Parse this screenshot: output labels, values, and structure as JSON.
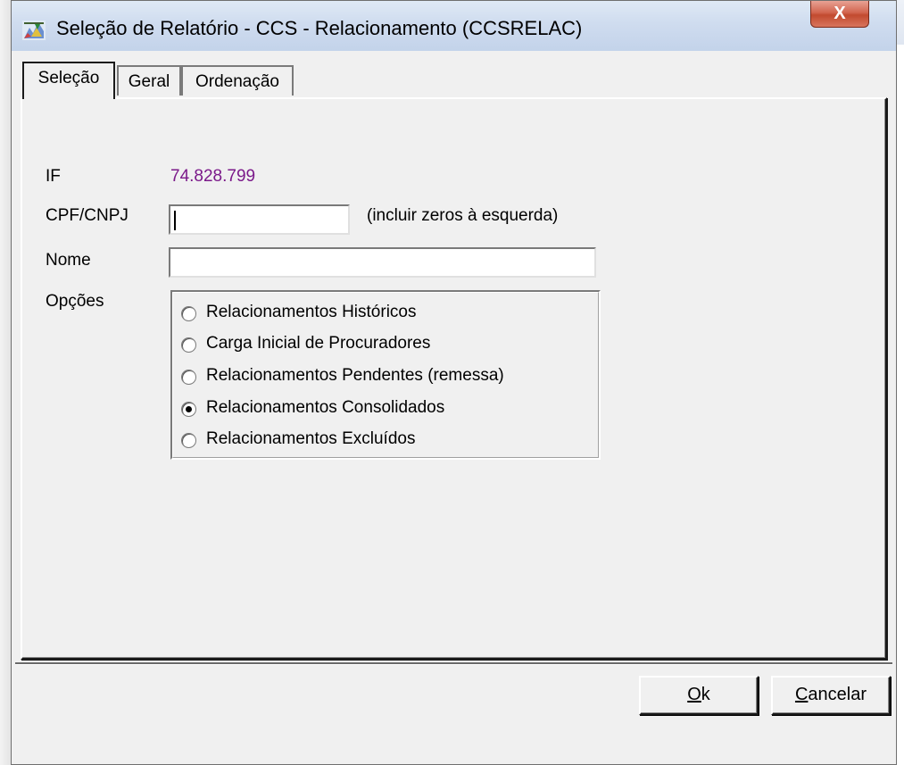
{
  "window": {
    "title": "Seleção de Relatório - CCS - Relacionamento (CCSRELAC)",
    "close_glyph": "X"
  },
  "tabs": [
    {
      "label": "Seleção",
      "active": true
    },
    {
      "label": "Geral",
      "active": false
    },
    {
      "label": "Ordenação",
      "active": false
    }
  ],
  "form": {
    "if_label": "IF",
    "if_value": "74.828.799",
    "cpf_label": "CPF/CNPJ",
    "cpf_value": "",
    "cpf_hint": "(incluir zeros à esquerda)",
    "nome_label": "Nome",
    "nome_value": "",
    "opcoes_label": "Opções",
    "options": [
      {
        "label": "Relacionamentos Históricos",
        "checked": false
      },
      {
        "label": "Carga Inicial de Procuradores",
        "checked": false
      },
      {
        "label": "Relacionamentos Pendentes (remessa)",
        "checked": false
      },
      {
        "label": "Relacionamentos Consolidados",
        "checked": true
      },
      {
        "label": "Relacionamentos Excluídos",
        "checked": false
      }
    ]
  },
  "buttons": {
    "ok_mnemonic": "O",
    "ok_rest": "k",
    "cancel_mnemonic": "C",
    "cancel_rest": "ancelar"
  },
  "colors": {
    "if_value": "#7b1a8a",
    "close_button": "#c24a2f"
  }
}
